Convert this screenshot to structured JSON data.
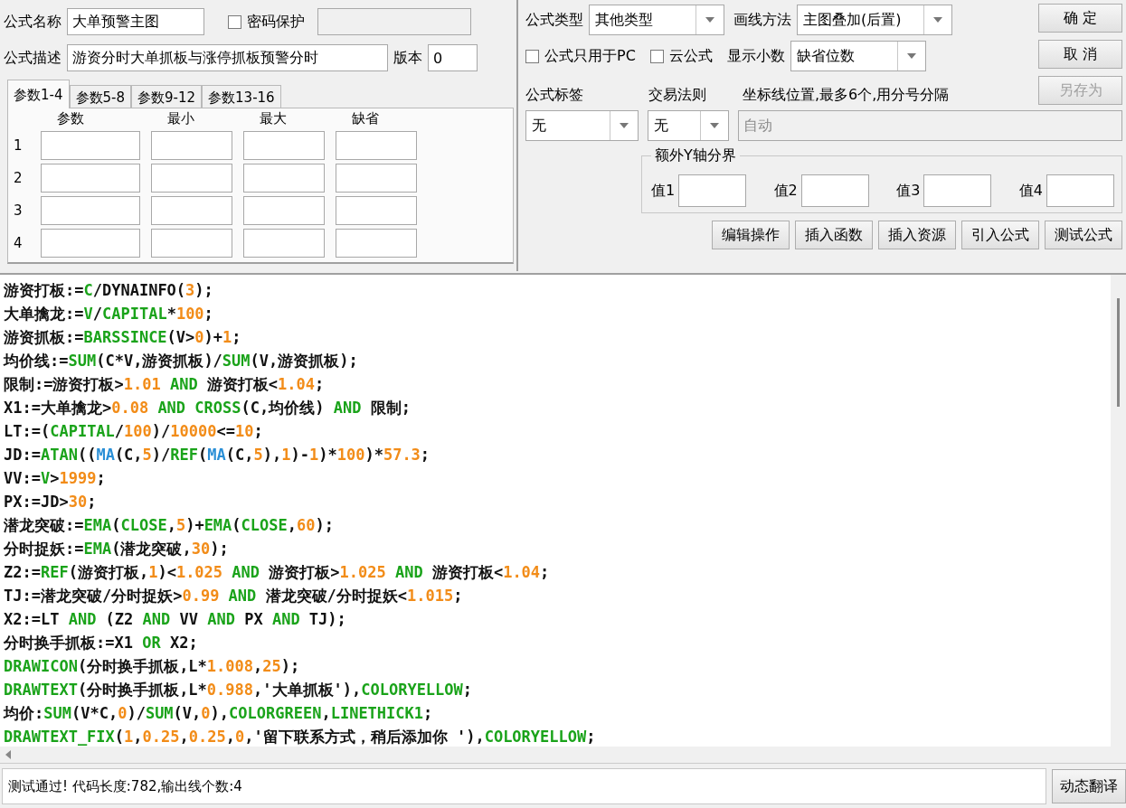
{
  "form": {
    "name_label": "公式名称",
    "name_value": "大单预警主图",
    "password": {
      "label": "密码保护",
      "checked": false
    },
    "desc_label": "公式描述",
    "desc_value": "游资分时大单抓板与涨停抓板预警分时",
    "version_label": "版本",
    "version_value": "0"
  },
  "param_tabs": [
    {
      "label": "参数1-4",
      "selected": true
    },
    {
      "label": "参数5-8",
      "selected": false
    },
    {
      "label": "参数9-12",
      "selected": false
    },
    {
      "label": "参数13-16",
      "selected": false
    }
  ],
  "param_table": {
    "columns": [
      "参数",
      "最小",
      "最大",
      "缺省"
    ],
    "rows": [
      "1",
      "2",
      "3",
      "4"
    ]
  },
  "type": {
    "label": "公式类型",
    "value": "其他类型"
  },
  "draw_method": {
    "label": "画线方法",
    "value": "主图叠加(后置)"
  },
  "pc_only": {
    "label": "公式只用于PC",
    "checked": false
  },
  "cloud": {
    "label": "云公式",
    "checked": false
  },
  "decimals": {
    "label": "显示小数",
    "value": "缺省位数"
  },
  "side_buttons": [
    {
      "label": "确 定",
      "disabled": false
    },
    {
      "label": "取 消",
      "disabled": false
    },
    {
      "label": "另存为",
      "disabled": true
    }
  ],
  "tag": {
    "label": "公式标签",
    "value": "无"
  },
  "rule": {
    "label": "交易法则",
    "value": "无"
  },
  "axis": {
    "label": "坐标线位置,最多6个,用分号分隔",
    "value": "自动",
    "disabled": true
  },
  "y_bounds": {
    "title": "额外Y轴分界",
    "fields": [
      "值1",
      "值2",
      "值3",
      "值4"
    ]
  },
  "action_buttons": [
    "编辑操作",
    "插入函数",
    "插入资源",
    "引入公式",
    "测试公式"
  ],
  "code_lines": [
    [
      {
        "kind": "text",
        "text": "游资打板:="
      },
      {
        "kind": "fn",
        "text": "C"
      },
      {
        "kind": "text",
        "text": "/DYNAINFO("
      },
      {
        "kind": "num",
        "text": "3"
      },
      {
        "kind": "text",
        "text": ");"
      }
    ],
    [
      {
        "kind": "text",
        "text": "大单擒龙:="
      },
      {
        "kind": "fn",
        "text": "V"
      },
      {
        "kind": "text",
        "text": "/"
      },
      {
        "kind": "fn",
        "text": "CAPITAL"
      },
      {
        "kind": "text",
        "text": "*"
      },
      {
        "kind": "num",
        "text": "100"
      },
      {
        "kind": "text",
        "text": ";"
      }
    ],
    [
      {
        "kind": "text",
        "text": "游资抓板:="
      },
      {
        "kind": "fn",
        "text": "BARSSINCE"
      },
      {
        "kind": "text",
        "text": "(V>"
      },
      {
        "kind": "num",
        "text": "0"
      },
      {
        "kind": "text",
        "text": ")+"
      },
      {
        "kind": "num",
        "text": "1"
      },
      {
        "kind": "text",
        "text": ";"
      }
    ],
    [
      {
        "kind": "text",
        "text": "均价线:="
      },
      {
        "kind": "fn",
        "text": "SUM"
      },
      {
        "kind": "text",
        "text": "(C*V,游资抓板)/"
      },
      {
        "kind": "fn",
        "text": "SUM"
      },
      {
        "kind": "text",
        "text": "(V,游资抓板);"
      }
    ],
    [
      {
        "kind": "text",
        "text": "限制:=游资打板>"
      },
      {
        "kind": "num",
        "text": "1.01 "
      },
      {
        "kind": "fn",
        "text": "AND"
      },
      {
        "kind": "text",
        "text": " 游资打板<"
      },
      {
        "kind": "num",
        "text": "1.04"
      },
      {
        "kind": "text",
        "text": ";"
      }
    ],
    [
      {
        "kind": "text",
        "text": "X1:=大单擒龙>"
      },
      {
        "kind": "num",
        "text": "0.08 "
      },
      {
        "kind": "fn",
        "text": "AND "
      },
      {
        "kind": "fn",
        "text": "CROSS"
      },
      {
        "kind": "text",
        "text": "(C,均价线) "
      },
      {
        "kind": "fn",
        "text": "AND"
      },
      {
        "kind": "text",
        "text": " 限制;"
      }
    ],
    [
      {
        "kind": "text",
        "text": "LT:=("
      },
      {
        "kind": "fn",
        "text": "CAPITAL"
      },
      {
        "kind": "text",
        "text": "/"
      },
      {
        "kind": "num",
        "text": "100"
      },
      {
        "kind": "text",
        "text": ")/"
      },
      {
        "kind": "num",
        "text": "10000"
      },
      {
        "kind": "text",
        "text": "<="
      },
      {
        "kind": "num",
        "text": "10"
      },
      {
        "kind": "text",
        "text": ";"
      }
    ],
    [
      {
        "kind": "text",
        "text": "JD:="
      },
      {
        "kind": "fn",
        "text": "ATAN"
      },
      {
        "kind": "text",
        "text": "(("
      },
      {
        "kind": "ma",
        "text": "MA"
      },
      {
        "kind": "text",
        "text": "(C,"
      },
      {
        "kind": "num",
        "text": "5"
      },
      {
        "kind": "text",
        "text": ")/"
      },
      {
        "kind": "fn",
        "text": "REF"
      },
      {
        "kind": "text",
        "text": "("
      },
      {
        "kind": "ma",
        "text": "MA"
      },
      {
        "kind": "text",
        "text": "(C,"
      },
      {
        "kind": "num",
        "text": "5"
      },
      {
        "kind": "text",
        "text": "),"
      },
      {
        "kind": "num",
        "text": "1"
      },
      {
        "kind": "text",
        "text": ")-"
      },
      {
        "kind": "num",
        "text": "1"
      },
      {
        "kind": "text",
        "text": ")*"
      },
      {
        "kind": "num",
        "text": "100"
      },
      {
        "kind": "text",
        "text": ")*"
      },
      {
        "kind": "num",
        "text": "57.3"
      },
      {
        "kind": "text",
        "text": ";"
      }
    ],
    [
      {
        "kind": "text",
        "text": "VV:="
      },
      {
        "kind": "fn",
        "text": "V"
      },
      {
        "kind": "text",
        "text": ">"
      },
      {
        "kind": "num",
        "text": "1999"
      },
      {
        "kind": "text",
        "text": ";"
      }
    ],
    [
      {
        "kind": "text",
        "text": "PX:=JD>"
      },
      {
        "kind": "num",
        "text": "30"
      },
      {
        "kind": "text",
        "text": ";"
      }
    ],
    [
      {
        "kind": "text",
        "text": "潜龙突破:="
      },
      {
        "kind": "fn",
        "text": "EMA"
      },
      {
        "kind": "text",
        "text": "("
      },
      {
        "kind": "fn",
        "text": "CLOSE"
      },
      {
        "kind": "text",
        "text": ","
      },
      {
        "kind": "num",
        "text": "5"
      },
      {
        "kind": "text",
        "text": ")+"
      },
      {
        "kind": "fn",
        "text": "EMA"
      },
      {
        "kind": "text",
        "text": "("
      },
      {
        "kind": "fn",
        "text": "CLOSE"
      },
      {
        "kind": "text",
        "text": ","
      },
      {
        "kind": "num",
        "text": "60"
      },
      {
        "kind": "text",
        "text": ");"
      }
    ],
    [
      {
        "kind": "text",
        "text": "分时捉妖:="
      },
      {
        "kind": "fn",
        "text": "EMA"
      },
      {
        "kind": "text",
        "text": "(潜龙突破,"
      },
      {
        "kind": "num",
        "text": "30"
      },
      {
        "kind": "text",
        "text": ");"
      }
    ],
    [
      {
        "kind": "text",
        "text": "Z2:="
      },
      {
        "kind": "fn",
        "text": "REF"
      },
      {
        "kind": "text",
        "text": "(游资打板,"
      },
      {
        "kind": "num",
        "text": "1"
      },
      {
        "kind": "text",
        "text": ")<"
      },
      {
        "kind": "num",
        "text": "1.025 "
      },
      {
        "kind": "fn",
        "text": "AND"
      },
      {
        "kind": "text",
        "text": " 游资打板>"
      },
      {
        "kind": "num",
        "text": "1.025 "
      },
      {
        "kind": "fn",
        "text": "AND"
      },
      {
        "kind": "text",
        "text": " 游资打板<"
      },
      {
        "kind": "num",
        "text": "1.04"
      },
      {
        "kind": "text",
        "text": ";"
      }
    ],
    [
      {
        "kind": "text",
        "text": "TJ:=潜龙突破/分时捉妖>"
      },
      {
        "kind": "num",
        "text": "0.99 "
      },
      {
        "kind": "fn",
        "text": "AND"
      },
      {
        "kind": "text",
        "text": " 潜龙突破/分时捉妖<"
      },
      {
        "kind": "num",
        "text": "1.015"
      },
      {
        "kind": "text",
        "text": ";"
      }
    ],
    [
      {
        "kind": "text",
        "text": "X2:=LT "
      },
      {
        "kind": "fn",
        "text": "AND"
      },
      {
        "kind": "text",
        "text": " (Z2 "
      },
      {
        "kind": "fn",
        "text": "AND"
      },
      {
        "kind": "text",
        "text": " VV "
      },
      {
        "kind": "fn",
        "text": "AND"
      },
      {
        "kind": "text",
        "text": " PX "
      },
      {
        "kind": "fn",
        "text": "AND"
      },
      {
        "kind": "text",
        "text": " TJ);"
      }
    ],
    [
      {
        "kind": "text",
        "text": "分时换手抓板:=X1 "
      },
      {
        "kind": "fn",
        "text": "OR"
      },
      {
        "kind": "text",
        "text": " X2;"
      }
    ],
    [
      {
        "kind": "fn",
        "text": "DRAWICON"
      },
      {
        "kind": "text",
        "text": "(分时换手抓板,L*"
      },
      {
        "kind": "num",
        "text": "1.008"
      },
      {
        "kind": "text",
        "text": ","
      },
      {
        "kind": "num",
        "text": "25"
      },
      {
        "kind": "text",
        "text": ");"
      }
    ],
    [
      {
        "kind": "fn",
        "text": "DRAWTEXT"
      },
      {
        "kind": "text",
        "text": "(分时换手抓板,L*"
      },
      {
        "kind": "num",
        "text": "0.988"
      },
      {
        "kind": "text",
        "text": ",'大单抓板'),"
      },
      {
        "kind": "fn",
        "text": "COLORYELLOW"
      },
      {
        "kind": "text",
        "text": ";"
      }
    ],
    [
      {
        "kind": "text",
        "text": "均价:"
      },
      {
        "kind": "fn",
        "text": "SUM"
      },
      {
        "kind": "text",
        "text": "(V*C,"
      },
      {
        "kind": "num",
        "text": "0"
      },
      {
        "kind": "text",
        "text": ")/"
      },
      {
        "kind": "fn",
        "text": "SUM"
      },
      {
        "kind": "text",
        "text": "(V,"
      },
      {
        "kind": "num",
        "text": "0"
      },
      {
        "kind": "text",
        "text": "),"
      },
      {
        "kind": "fn",
        "text": "COLORGREEN"
      },
      {
        "kind": "text",
        "text": ","
      },
      {
        "kind": "fn",
        "text": "LINETHICK1"
      },
      {
        "kind": "text",
        "text": ";"
      }
    ],
    [
      {
        "kind": "fn",
        "text": "DRAWTEXT_FIX"
      },
      {
        "kind": "text",
        "text": "("
      },
      {
        "kind": "num",
        "text": "1"
      },
      {
        "kind": "text",
        "text": ","
      },
      {
        "kind": "num",
        "text": "0.25"
      },
      {
        "kind": "text",
        "text": ","
      },
      {
        "kind": "num",
        "text": "0.25"
      },
      {
        "kind": "text",
        "text": ","
      },
      {
        "kind": "num",
        "text": "0"
      },
      {
        "kind": "text",
        "text": ",'留下联系方式，稍后添加你 '),"
      },
      {
        "kind": "fn",
        "text": "COLORYELLOW"
      },
      {
        "kind": "text",
        "text": ";"
      }
    ]
  ],
  "status": {
    "message": "测试通过! 代码长度:782,输出线个数:4",
    "button": "动态翻译"
  }
}
